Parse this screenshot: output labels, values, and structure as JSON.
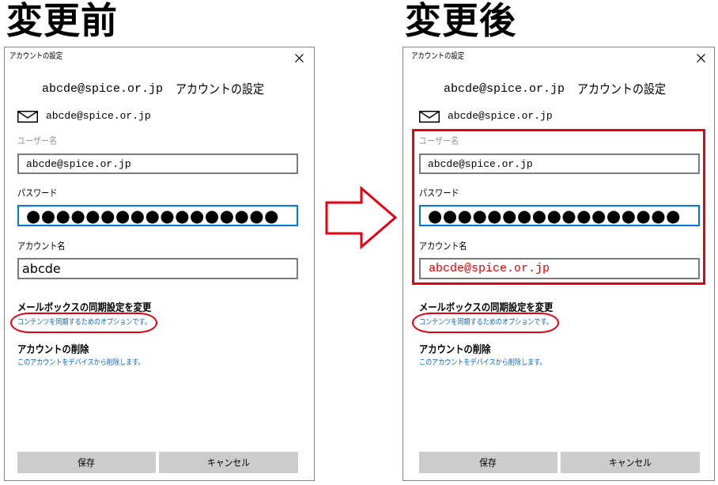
{
  "colors": {
    "annotation_red": "#e60012",
    "link_blue": "#0066cc",
    "focus_blue": "#0078d7",
    "window_border": "#4f8ed8",
    "button_gray": "#cccccc",
    "label_gray": "#999999",
    "changed_value_red": "#e60000"
  },
  "icons": {
    "close": "close-icon",
    "mail": "mail-icon",
    "arrow": "right-arrow-icon"
  },
  "panels": [
    {
      "heading": "変更前",
      "dialog": {
        "window_title": "アカウントの設定",
        "header_account": "abcde@spice.or.jp",
        "header_title": "アカウントの設定",
        "email": "abcde@spice.or.jp",
        "username": {
          "label": "ユーザー名",
          "value": "abcde@spice.or.jp"
        },
        "password": {
          "label": "パスワード",
          "value": "●●●●●●●●●●●●●●●●●"
        },
        "account_name": {
          "label": "アカウント名",
          "value": "abcde"
        },
        "sync": {
          "title": "メールボックスの同期設定を変更",
          "link": "コンテンツを同期するためのオプションです。"
        },
        "delete": {
          "title": "アカウントの削除",
          "link": "このアカウントをデバイスから削除します。"
        },
        "buttons": {
          "save": "保存",
          "cancel": "キャンセル"
        }
      }
    },
    {
      "heading": "変更後",
      "dialog": {
        "window_title": "アカウントの設定",
        "header_account": "abcde@spice.or.jp",
        "header_title": "アカウントの設定",
        "email": "abcde@spice.or.jp",
        "username": {
          "label": "ユーザー名",
          "value": "abcde@spice.or.jp"
        },
        "password": {
          "label": "パスワード",
          "value": "●●●●●●●●●●●●●●●●●"
        },
        "account_name": {
          "label": "アカウント名",
          "value": "abcde@spice.or.jp"
        },
        "sync": {
          "title": "メールボックスの同期設定を変更",
          "link": "コンテンツを同期するためのオプションです。"
        },
        "delete": {
          "title": "アカウントの削除",
          "link": "このアカウントをデバイスから削除します。"
        },
        "buttons": {
          "save": "保存",
          "cancel": "キャンセル"
        }
      }
    }
  ]
}
